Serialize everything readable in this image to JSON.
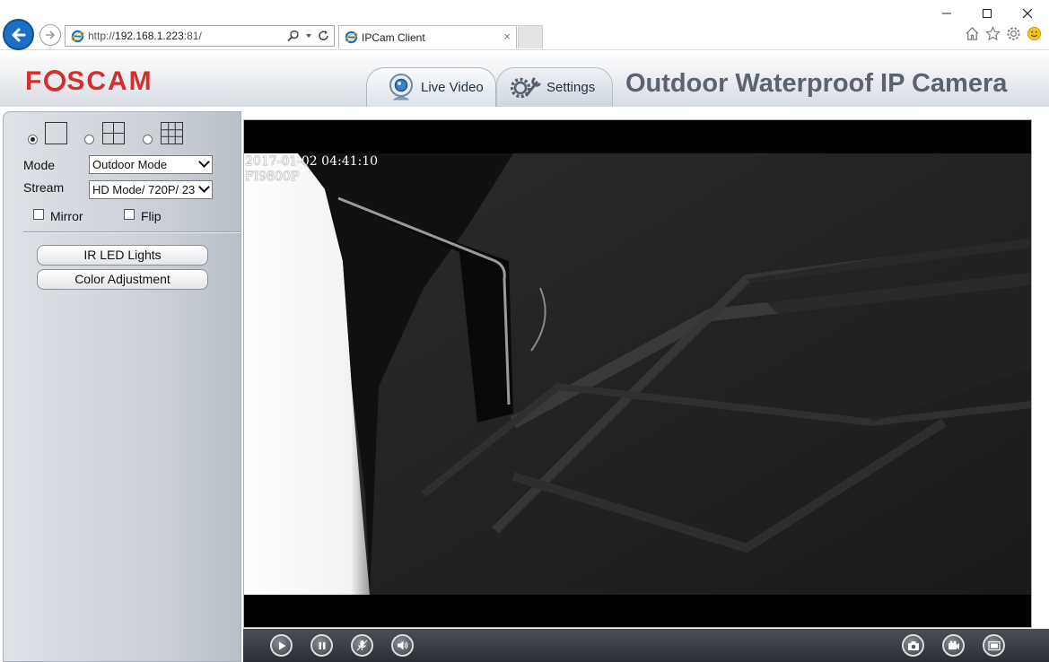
{
  "browser": {
    "url_scheme": "http://",
    "url_host": "192.168.1.223",
    "url_port": ":81/",
    "tab_title": "IPCam Client",
    "tab_close": "×"
  },
  "app": {
    "logo_pre": "F",
    "logo_post": "SCAM",
    "tabs": [
      {
        "label": "Live Video",
        "active": true
      },
      {
        "label": "Settings",
        "active": false
      }
    ],
    "product_title": "Outdoor Waterproof IP Camera"
  },
  "left_panel": {
    "layouts": [
      {
        "name": "1-view",
        "checked": true
      },
      {
        "name": "4-view",
        "checked": false
      },
      {
        "name": "9-view",
        "checked": false
      }
    ],
    "mode_label": "Mode",
    "mode_value": "Outdoor Mode",
    "stream_label": "Stream",
    "stream_value": "HD Mode/ 720P/ 23",
    "mirror_label": "Mirror",
    "mirror_checked": false,
    "flip_label": "Flip",
    "flip_checked": false,
    "ir_button": "IR LED Lights",
    "color_button": "Color Adjustment"
  },
  "video": {
    "timestamp": "2017-01-02 04:41:10",
    "model": "FI9800P"
  },
  "controls": {
    "left": [
      "play-icon",
      "stop-icon",
      "mic-icon",
      "speaker-icon"
    ],
    "right": [
      "snapshot-icon",
      "record-icon",
      "fullscreen-icon"
    ]
  },
  "colors": {
    "brand_red": "#d32f2f",
    "browser_blue": "#1c6fc4",
    "title_gray": "#5a6470",
    "video_border": "#c9b45a"
  }
}
